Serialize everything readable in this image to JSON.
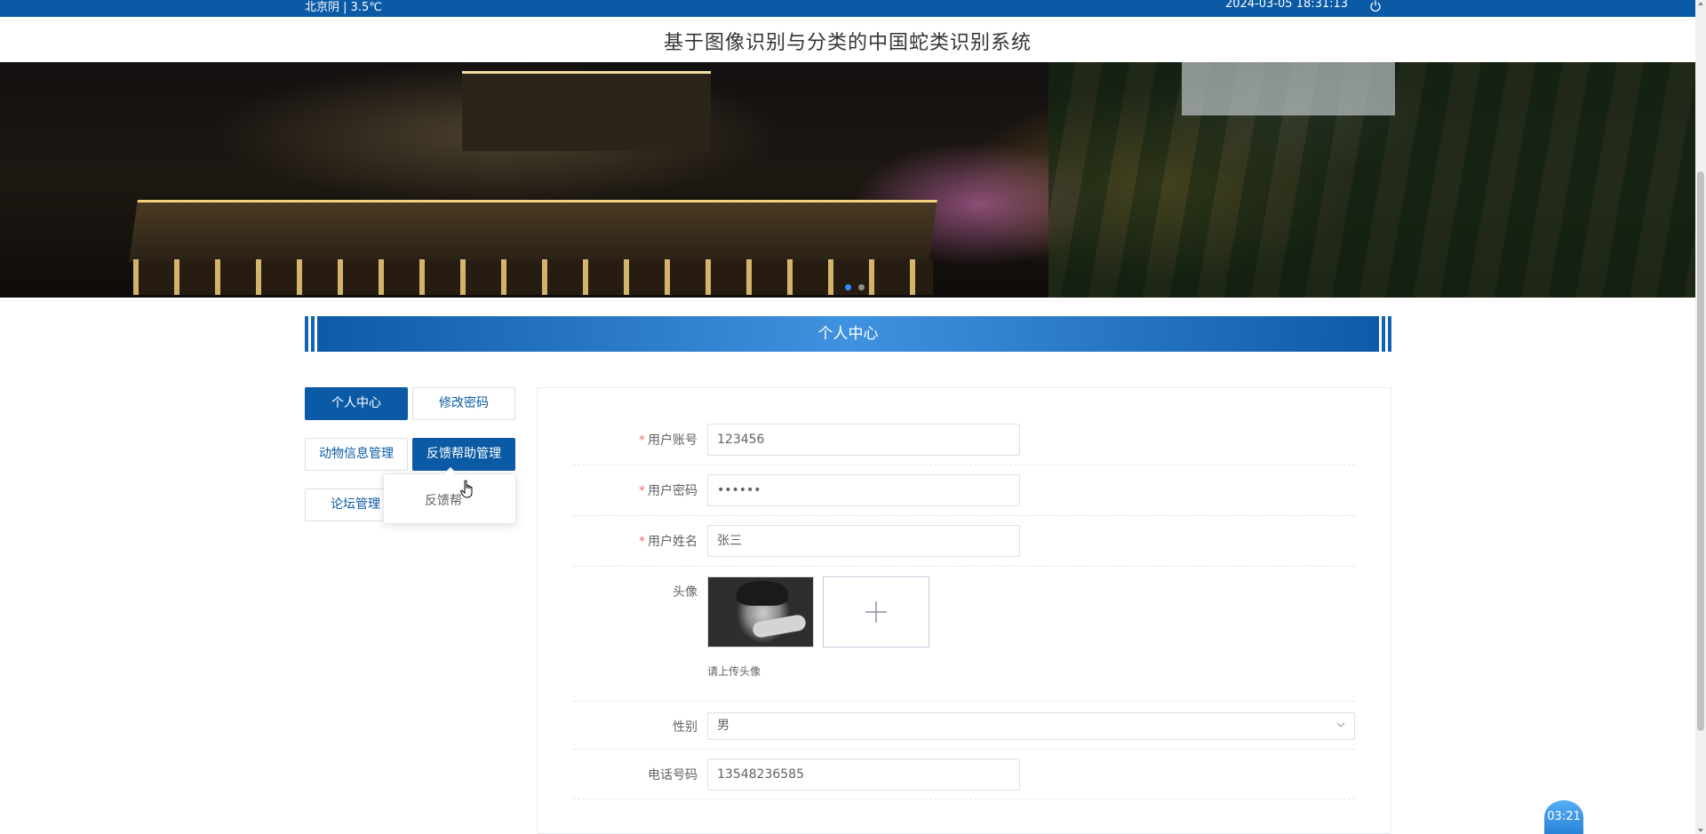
{
  "topbar": {
    "weather": "北京阴 | 3.5℃",
    "datetime": "2024-03-05   18:31:13",
    "power_icon": "power-icon"
  },
  "header": {
    "title": "基于图像识别与分类的中国蛇类识别系统"
  },
  "section": {
    "title": "个人中心"
  },
  "nav": {
    "items": [
      {
        "label": "个人中心",
        "active": true
      },
      {
        "label": "修改密码",
        "active": false
      },
      {
        "label": "动物信息管理",
        "active": false
      },
      {
        "label": "反馈帮助管理",
        "active": true
      },
      {
        "label": "论坛管理",
        "active": false
      }
    ],
    "dropdown_item": "反馈帮"
  },
  "form": {
    "account": {
      "label": "用户账号",
      "required": "*",
      "value": "123456"
    },
    "password": {
      "label": "用户密码",
      "required": "*",
      "value": "••••••"
    },
    "name": {
      "label": "用户姓名",
      "required": "*",
      "value": "张三"
    },
    "avatar": {
      "label": "头像",
      "hint": "请上传头像"
    },
    "gender": {
      "label": "性别",
      "value": "男"
    },
    "phone": {
      "label": "电话号码",
      "value": "13548236585"
    }
  },
  "timer": {
    "value": "03:21"
  },
  "colors": {
    "primary": "#0b5aa6",
    "required": "#f56c6c"
  }
}
